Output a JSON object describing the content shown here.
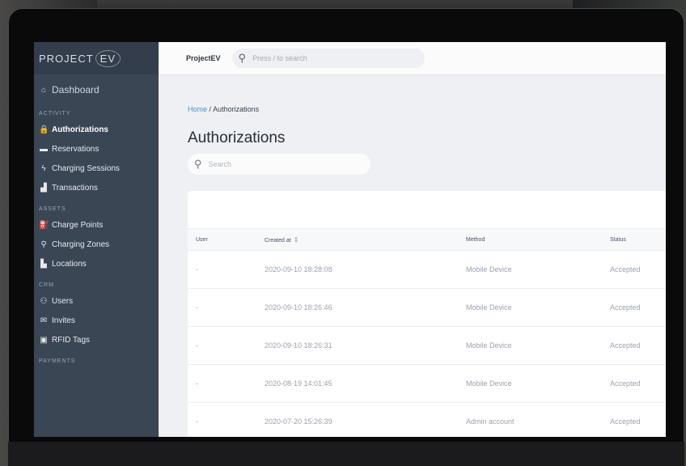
{
  "brand": {
    "text": "PROJECT",
    "ev": "EV"
  },
  "sidebar": {
    "dashboard": "Dashboard",
    "sections": [
      {
        "title": "ACTIVITY",
        "items": [
          {
            "label": "Authorizations",
            "icon": "lock-icon",
            "active": true
          },
          {
            "label": "Reservations",
            "icon": "card-icon"
          },
          {
            "label": "Charging Sessions",
            "icon": "bolt-icon"
          },
          {
            "label": "Transactions",
            "icon": "bank-icon"
          }
        ]
      },
      {
        "title": "ASSETS",
        "items": [
          {
            "label": "Charge Points",
            "icon": "charger-icon"
          },
          {
            "label": "Charging Zones",
            "icon": "pin-icon"
          },
          {
            "label": "Locations",
            "icon": "buildings-icon"
          }
        ]
      },
      {
        "title": "CRM",
        "items": [
          {
            "label": "Users",
            "icon": "users-icon"
          },
          {
            "label": "Invites",
            "icon": "mail-icon"
          },
          {
            "label": "RFID Tags",
            "icon": "id-card-icon"
          }
        ]
      },
      {
        "title": "PAYMENTS",
        "items": []
      }
    ]
  },
  "topbar": {
    "brand": "ProjectEV",
    "search_placeholder": "Press / to search"
  },
  "breadcrumb": {
    "home": "Home",
    "sep": "/",
    "current": "Authorizations"
  },
  "page": {
    "title": "Authorizations",
    "search_placeholder": "Search"
  },
  "table": {
    "columns": [
      "User",
      "Created at",
      "Method",
      "Status"
    ],
    "rows": [
      [
        "-",
        "2020-09-10 18:28:08",
        "Mobile Device",
        "Accepted"
      ],
      [
        "-",
        "2020-09-10 18:26:46",
        "Mobile Device",
        "Accepted"
      ],
      [
        "-",
        "2020-09-10 18:26:31",
        "Mobile Device",
        "Accepted"
      ],
      [
        "-",
        "2020-08-19 14:01:45",
        "Mobile Device",
        "Accepted"
      ],
      [
        "-",
        "2020-07-20 15:26:39",
        "Admin account",
        "Accepted"
      ]
    ]
  },
  "colors": {
    "sidebar": "#3b4655",
    "accent": "#4d8ec9",
    "content_bg": "#eef0f3"
  }
}
